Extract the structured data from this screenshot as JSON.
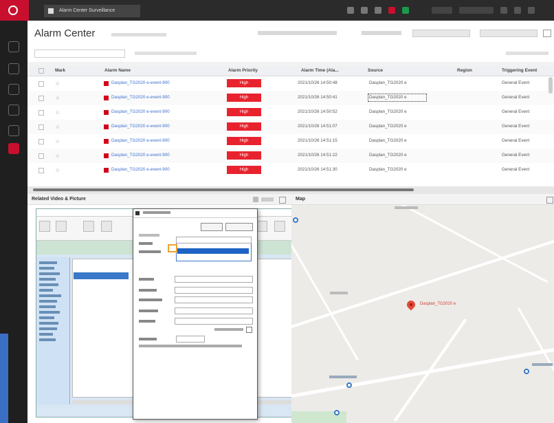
{
  "app": {
    "tab_title": "Alarm Center Surveillance"
  },
  "header": {
    "title": "Alarm Center"
  },
  "table": {
    "columns": [
      "Mark",
      "Alarm Name",
      "Alarm Priority",
      "Alarm Time (Ala...",
      "Source",
      "Region",
      "Triggering Event"
    ],
    "rows": [
      {
        "name": "Dasplan_TG2020 e-event-900",
        "priority": "High",
        "time": "2021/10/26 14:50:48",
        "source": "Dasplan_TG2020 e",
        "event": "General Event"
      },
      {
        "name": "Dasplan_TG2020 e-event-900",
        "priority": "High",
        "time": "2021/10/26 14:50:41",
        "source": "Dasplan_TG2020 e",
        "event": "General Event"
      },
      {
        "name": "Dasplan_TG2020 e-event-900",
        "priority": "High",
        "time": "2021/10/26 14:50:52",
        "source": "Dasplan_TG2020 e",
        "event": "General Event"
      },
      {
        "name": "Dasplan_TG2020 e-event-900",
        "priority": "High",
        "time": "2021/10/26 14:51:07",
        "source": "Dasplan_TG2020 e",
        "event": "General Event"
      },
      {
        "name": "Dasplan_TG2020 e-event-900",
        "priority": "High",
        "time": "2021/10/26 14:51:15",
        "source": "Dasplan_TG2020 e",
        "event": "General Event"
      },
      {
        "name": "Dasplan_TG2020 e-event-900",
        "priority": "High",
        "time": "2021/10/26 14:51:22",
        "source": "Dasplan_TG2020 e",
        "event": "General Event"
      },
      {
        "name": "Dasplan_TG2020 e-event-900",
        "priority": "High",
        "time": "2021/10/26 14:51:30",
        "source": "Dasplan_TG2020 e",
        "event": "General Event"
      }
    ]
  },
  "video_panel": {
    "title": "Related Video & Picture"
  },
  "map_panel": {
    "title": "Map",
    "pin_label": "Dasplan_TG2020 e"
  },
  "colors": {
    "brand": "#c8102e",
    "priority_high": "#e8232e",
    "link": "#3b6fd1"
  }
}
